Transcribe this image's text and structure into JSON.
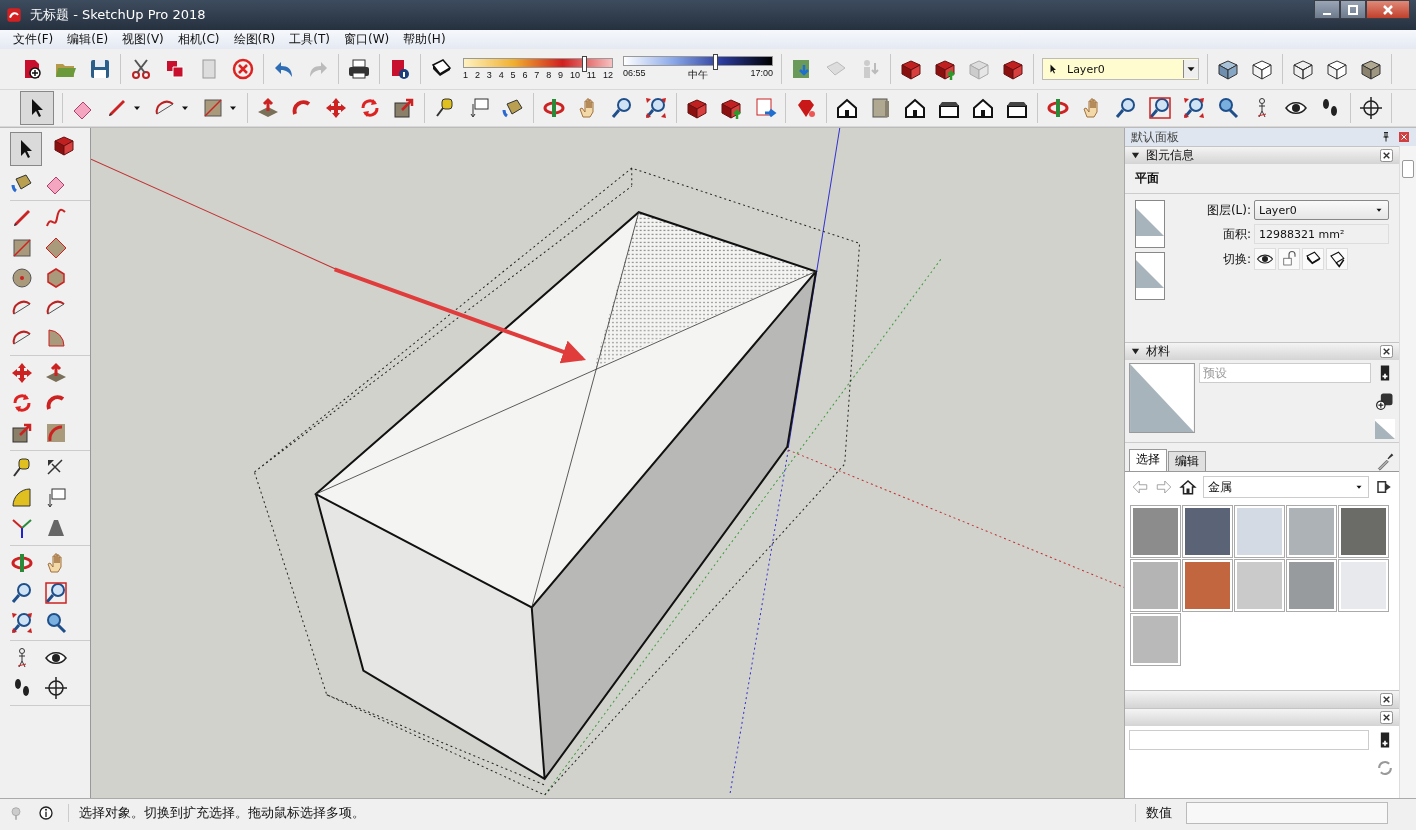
{
  "window": {
    "title": "无标题 - SketchUp Pro 2018"
  },
  "menu": [
    "文件(F)",
    "编辑(E)",
    "视图(V)",
    "相机(C)",
    "绘图(R)",
    "工具(T)",
    "窗口(W)",
    "帮助(H)"
  ],
  "shadows": {
    "date_slider": {
      "level": 0.8,
      "months": [
        "1",
        "2",
        "3",
        "4",
        "5",
        "6",
        "7",
        "8",
        "9",
        "10",
        "11",
        "12"
      ]
    },
    "time_slider": {
      "level": 0.6,
      "time_start": "06:55",
      "time_mid": "中午",
      "time_end": "17:00"
    }
  },
  "layer_toolbar": {
    "value": "Layer0"
  },
  "tray": {
    "title": "默认面板",
    "entity_info": {
      "title": "图元信息",
      "expanded": true,
      "entity_type": "平面",
      "layer_label": "图层(L):",
      "layer_value": "Layer0",
      "area_label": "面积:",
      "area_value": "12988321 mm²",
      "toggle_label": "切换:"
    },
    "materials": {
      "title": "材料",
      "expanded": true,
      "name_placeholder": "预设",
      "tabs": [
        {
          "label": "选择",
          "selected": true
        },
        {
          "label": "编辑",
          "selected": false
        }
      ],
      "library": "金属",
      "swatches": [
        {
          "color": "#8c8c8c"
        },
        {
          "color": "#5b6377"
        },
        {
          "color": "#d3dae3"
        },
        {
          "color": "#adb2b6"
        },
        {
          "color": "#6b6b68"
        },
        {
          "color": "#b4b4b4"
        },
        {
          "color": "#c2663f"
        },
        {
          "color": "#cacaca"
        },
        {
          "color": "#979b9e"
        },
        {
          "color": "#e7e9ed"
        },
        {
          "color": "#b9b9b9"
        }
      ]
    }
  },
  "status_bar": {
    "message": "选择对象。切换到扩充选择。拖动鼠标选择多项。",
    "measurements_label": "数值"
  }
}
